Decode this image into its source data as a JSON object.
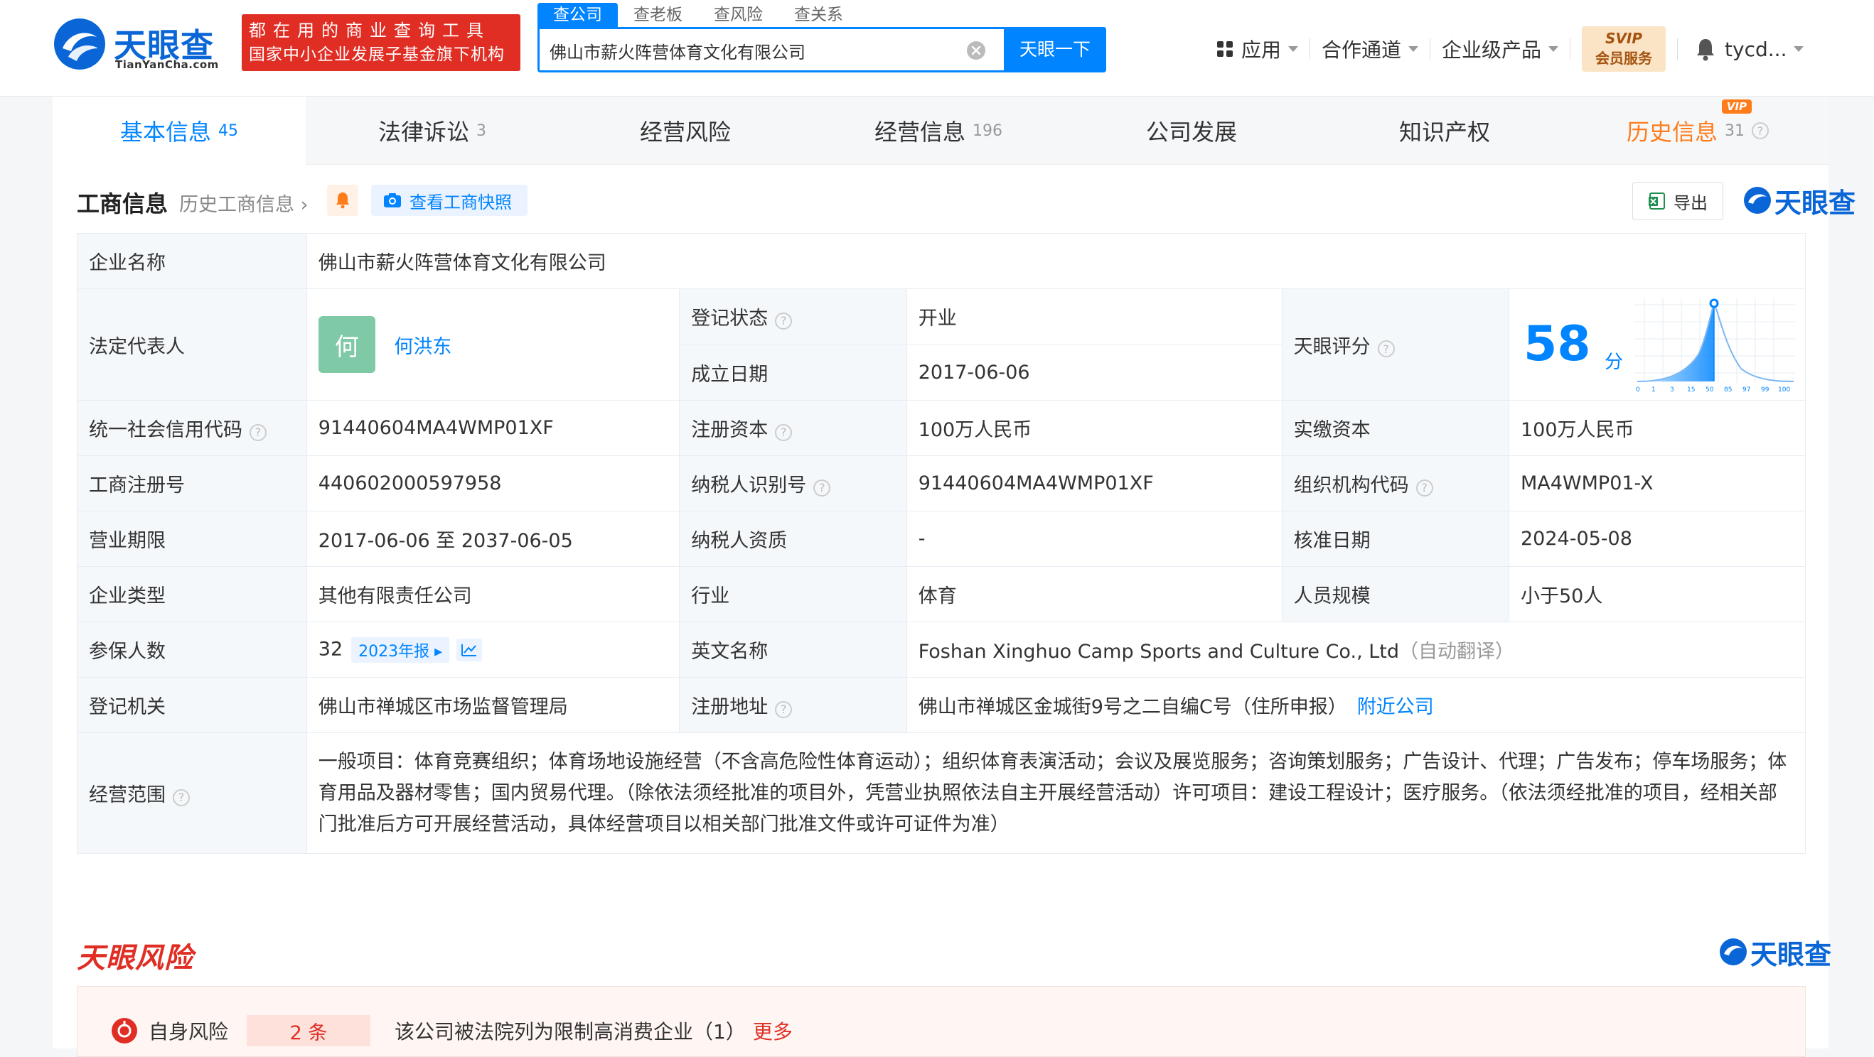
{
  "header": {
    "logo_cn": "天眼查",
    "logo_en": "TianYanCha.com",
    "slogan_line1": "都在用的商业查询工具",
    "slogan_line2": "国家中小企业发展子基金旗下机构",
    "search_tabs": [
      "查公司",
      "查老板",
      "查风险",
      "查关系"
    ],
    "search_value": "佛山市薪火阵营体育文化有限公司",
    "search_button": "天眼一下",
    "nav": {
      "apps": "应用",
      "channel": "合作通道",
      "enterprise": "企业级产品",
      "svip_t1": "SVIP",
      "svip_t2": "会员服务",
      "user": "tycd..."
    }
  },
  "tabs": [
    {
      "label": "基本信息",
      "count": "45"
    },
    {
      "label": "法律诉讼",
      "count": "3"
    },
    {
      "label": "经营风险",
      "count": ""
    },
    {
      "label": "经营信息",
      "count": "196"
    },
    {
      "label": "公司发展",
      "count": ""
    },
    {
      "label": "知识产权",
      "count": ""
    },
    {
      "label": "历史信息",
      "count": "31",
      "tag": "VIP"
    }
  ],
  "section": {
    "title": "工商信息",
    "history_link": "历史工商信息",
    "snapshot": "查看工商快照",
    "export": "导出",
    "brand": "天眼查"
  },
  "info": {
    "company_name_k": "企业名称",
    "company_name_v": "佛山市薪火阵营体育文化有限公司",
    "legal_rep_k": "法定代表人",
    "legal_rep_avatar": "何",
    "legal_rep_v": "何洪东",
    "reg_status_k": "登记状态",
    "reg_status_v": "开业",
    "found_date_k": "成立日期",
    "found_date_v": "2017-06-06",
    "score_k": "天眼评分",
    "score_v": "58",
    "score_unit": "分",
    "score_ticks": [
      "0",
      "1",
      "3",
      "15",
      "50",
      "85",
      "97",
      "99",
      "100"
    ],
    "credit_code_k": "统一社会信用代码",
    "credit_code_v": "91440604MA4WMP01XF",
    "reg_capital_k": "注册资本",
    "reg_capital_v": "100万人民币",
    "paid_capital_k": "实缴资本",
    "paid_capital_v": "100万人民币",
    "reg_no_k": "工商注册号",
    "reg_no_v": "440602000597958",
    "taxpayer_id_k": "纳税人识别号",
    "taxpayer_id_v": "91440604MA4WMP01XF",
    "org_code_k": "组织机构代码",
    "org_code_v": "MA4WMP01-X",
    "term_k": "营业期限",
    "term_v": "2017-06-06 至 2037-06-05",
    "taxpayer_q_k": "纳税人资质",
    "taxpayer_q_v": "-",
    "approve_date_k": "核准日期",
    "approve_date_v": "2024-05-08",
    "type_k": "企业类型",
    "type_v": "其他有限责任公司",
    "industry_k": "行业",
    "industry_v": "体育",
    "staff_k": "人员规模",
    "staff_v": "小于50人",
    "insured_k": "参保人数",
    "insured_v": "32",
    "insured_report": "2023年报",
    "english_k": "英文名称",
    "english_v": "Foshan Xinghuo Camp Sports and Culture Co., Ltd",
    "english_note": "（自动翻译）",
    "authority_k": "登记机关",
    "authority_v": "佛山市禅城区市场监督管理局",
    "address_k": "注册地址",
    "address_v": "佛山市禅城区金城街9号之二自编C号（住所申报）",
    "address_link": "附近公司",
    "scope_k": "经营范围",
    "scope_v": "一般项目：体育竞赛组织；体育场地设施经营（不含高危险性体育运动）；组织体育表演活动；会议及展览服务；咨询策划服务；广告设计、代理；广告发布；停车场服务；体育用品及器材零售；国内贸易代理。（除依法须经批准的项目外，凭营业执照依法自主开展经营活动）许可项目：建设工程设计；医疗服务。（依法须经批准的项目，经相关部门批准后方可开展经营活动，具体经营项目以相关部门批准文件或许可证件为准）"
  },
  "risk": {
    "title": "天眼风险",
    "brand": "天眼查",
    "self_label": "自身风险",
    "self_count": "2 条",
    "desc": "该公司被法院列为限制高消费企业（1）",
    "more": "更多"
  },
  "colors": {
    "brand_blue": "#0084ff",
    "logo_blue": "#0a66d6",
    "red": "#e02e24",
    "green": "#1a9e38",
    "orange": "#ff7c1b"
  }
}
